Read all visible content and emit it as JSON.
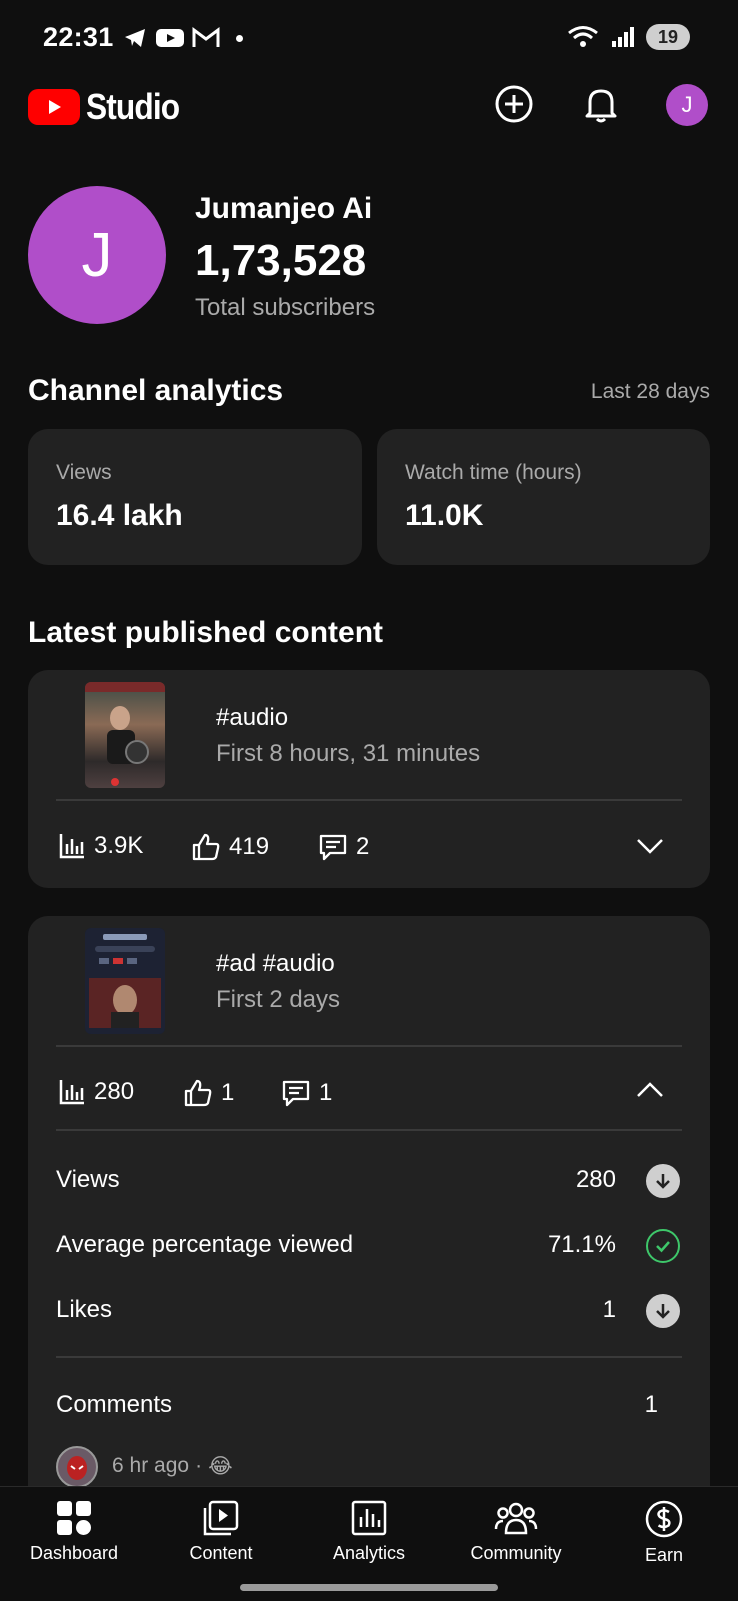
{
  "status_bar": {
    "time": "22:31",
    "battery": "19"
  },
  "header": {
    "brand": "Studio",
    "avatar_initial": "J"
  },
  "channel": {
    "avatar_initial": "J",
    "name": "Jumanjeo Ai",
    "subscribers": "1,73,528",
    "subscribers_label": "Total subscribers"
  },
  "analytics": {
    "title": "Channel analytics",
    "range": "Last 28 days",
    "cards": [
      {
        "label": "Views",
        "value": "16.4 lakh"
      },
      {
        "label": "Watch time (hours)",
        "value": "11.0K"
      }
    ]
  },
  "latest": {
    "title": "Latest published content",
    "videos": [
      {
        "title": "#audio",
        "subtitle": "First 8 hours, 31 minutes",
        "views": "3.9K",
        "likes": "419",
        "comments": "2"
      },
      {
        "title": "#ad #audio",
        "subtitle": "First 2 days",
        "views": "280",
        "likes": "1",
        "comments": "1",
        "details": [
          {
            "label": "Views",
            "value": "280",
            "status": "down"
          },
          {
            "label": "Average percentage viewed",
            "value": "71.1%",
            "status": "good"
          },
          {
            "label": "Likes",
            "value": "1",
            "status": "down"
          }
        ],
        "comments_label": "Comments",
        "comments_count": "1",
        "latest_comment": {
          "time": "6 hr ago",
          "emoji": "😂"
        }
      }
    ]
  },
  "bottom_nav": {
    "items": [
      {
        "label": "Dashboard",
        "icon": "dashboard-icon"
      },
      {
        "label": "Content",
        "icon": "content-icon"
      },
      {
        "label": "Analytics",
        "icon": "analytics-icon"
      },
      {
        "label": "Community",
        "icon": "community-icon"
      },
      {
        "label": "Earn",
        "icon": "earn-icon"
      }
    ]
  },
  "colors": {
    "background": "#0f0f0f",
    "card": "#222222",
    "avatar": "#b04ec9",
    "brand_red": "#ff0000",
    "good": "#3ec76a"
  }
}
